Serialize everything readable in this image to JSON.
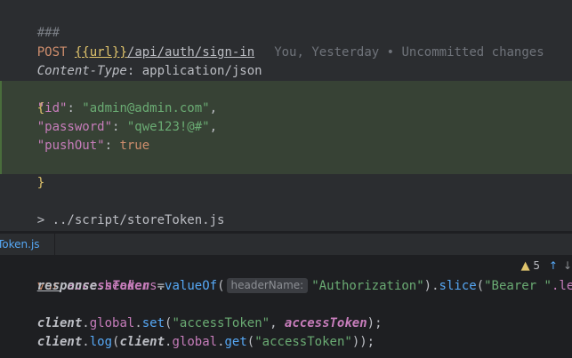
{
  "request_file": {
    "separator": "###",
    "method": "POST",
    "url_var": "{{url}}",
    "path_segments": [
      "/api/auth/",
      "sign-in"
    ],
    "blame": "You, Yesterday • Uncommitted changes",
    "header_name": "Content-Type",
    "header_value": ": application/json",
    "open_brace": "{",
    "close_brace": "}",
    "body": [
      {
        "key": "\"id\"",
        "value": "\"admin@admin.com\"",
        "sep": ": ",
        "trail": ","
      },
      {
        "key": "\"password\"",
        "value": "\"qwe123!@#\"",
        "sep": ": ",
        "trail": ","
      },
      {
        "key": "\"pushOut\"",
        "value": "true",
        "sep": ": ",
        "trail": ""
      }
    ],
    "response_handler": "> ../script/storeToken.js"
  },
  "tab": {
    "label": "Token.js"
  },
  "script_file": {
    "line1_kw": "var",
    "line1_ident": "accessToken",
    "line1_eq": " =",
    "line2_obj": "response",
    "line2_dot1": ".",
    "line2_member": "headers",
    "line2_dot2": ".",
    "line2_fn": "valueOf",
    "line2_paren": "(",
    "line2_inlay": "headerName:",
    "line2_arg": "\"Authorization\"",
    "line2_close": ").",
    "line2_fn2": "slice",
    "line2_paren2": "(",
    "line2_arg2": "\"Bearer \"",
    "line2_tail": ".length",
    "line3_obj": "client",
    "line3_dot1": ".",
    "line3_member": "global",
    "line3_dot2": ".",
    "line3_fn": "set",
    "line3_paren": "(",
    "line3_arg1": "\"accessToken\"",
    "line3_comma": ", ",
    "line3_arg2": "accessToken",
    "line3_close": ");",
    "line4_obj": "client",
    "line4_dot1": ".",
    "line4_fn": "log",
    "line4_paren": "(",
    "line4_obj2": "client",
    "line4_dot2": ".",
    "line4_member": "global",
    "line4_dot3": ".",
    "line4_fn2": "get",
    "line4_paren2": "(",
    "line4_arg": "\"accessToken\"",
    "line4_close": "));"
  },
  "inspection_widget": {
    "icon": "warning-triangle-icon",
    "count": "5",
    "up_icon": "arrow-up-icon",
    "down_icon": "arrow-down-icon"
  },
  "colors": {
    "editor_bg": "#2b2d30",
    "lower_bg": "#1e1f22",
    "diff_highlight": "#374235",
    "string_green": "#6aab73",
    "keyword_orange": "#cf8e6d",
    "key_purple": "#c77dbb",
    "function_blue": "#56a8f5"
  }
}
